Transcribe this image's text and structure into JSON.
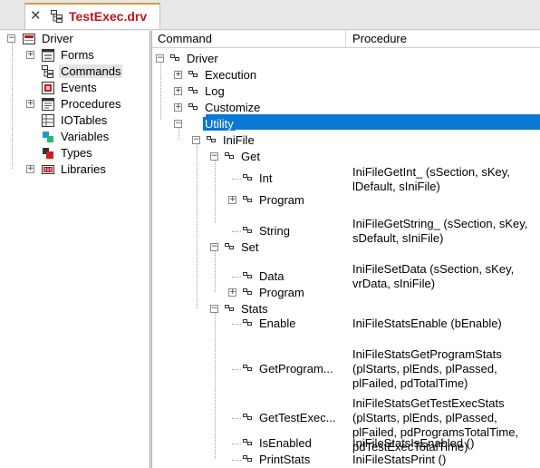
{
  "tab": {
    "close_glyph": "✕",
    "title": "TestExec.drv"
  },
  "left_tree": {
    "root": "Driver",
    "items": [
      {
        "label": "Forms",
        "expandable": true,
        "icon": "forms-icon"
      },
      {
        "label": "Commands",
        "expandable": false,
        "icon": "commands-icon",
        "selected": true
      },
      {
        "label": "Events",
        "expandable": false,
        "icon": "events-icon"
      },
      {
        "label": "Procedures",
        "expandable": true,
        "icon": "procedures-icon"
      },
      {
        "label": "IOTables",
        "expandable": false,
        "icon": "iotables-icon"
      },
      {
        "label": "Variables",
        "expandable": false,
        "icon": "variables-icon"
      },
      {
        "label": "Types",
        "expandable": false,
        "icon": "types-icon"
      },
      {
        "label": "Libraries",
        "expandable": true,
        "icon": "libraries-icon"
      }
    ]
  },
  "columns": {
    "command": "Command",
    "procedure": "Procedure"
  },
  "command_tree": [
    {
      "id": "driver",
      "label": "Driver",
      "procedure": "",
      "expander": "minus",
      "level": 0
    },
    {
      "id": "execution",
      "label": "Execution",
      "procedure": "",
      "expander": "plus",
      "level": 1
    },
    {
      "id": "log",
      "label": "Log",
      "procedure": "",
      "expander": "plus",
      "level": 1
    },
    {
      "id": "customize",
      "label": "Customize",
      "procedure": "",
      "expander": "plus",
      "level": 1
    },
    {
      "id": "utility",
      "label": "Utility",
      "procedure": "",
      "expander": "minus",
      "level": 1,
      "selected": true
    },
    {
      "id": "inifile",
      "label": "IniFile",
      "procedure": "",
      "expander": "minus",
      "level": 2
    },
    {
      "id": "get",
      "label": "Get",
      "procedure": "",
      "expander": "minus",
      "level": 3
    },
    {
      "id": "get-int",
      "label": "Int",
      "procedure": "IniFileGetInt_ (sSection, sKey, lDefault, sIniFile)",
      "expander": "none",
      "level": 4
    },
    {
      "id": "get-program",
      "label": "Program",
      "procedure": "",
      "expander": "plus",
      "level": 4
    },
    {
      "id": "get-string",
      "label": "String",
      "procedure": "IniFileGetString_ (sSection, sKey, sDefault, sIniFile)",
      "expander": "none",
      "level": 4
    },
    {
      "id": "set",
      "label": "Set",
      "procedure": "",
      "expander": "minus",
      "level": 3
    },
    {
      "id": "set-data",
      "label": "Data",
      "procedure": "IniFileSetData (sSection, sKey, vrData, sIniFile)",
      "expander": "none",
      "level": 4
    },
    {
      "id": "set-program",
      "label": "Program",
      "procedure": "",
      "expander": "plus",
      "level": 4
    },
    {
      "id": "stats",
      "label": "Stats",
      "procedure": "",
      "expander": "minus",
      "level": 3
    },
    {
      "id": "stats-enable",
      "label": "Enable",
      "procedure": "IniFileStatsEnable (bEnable)",
      "expander": "none",
      "level": 4
    },
    {
      "id": "stats-getprogram",
      "label": "GetProgram...",
      "procedure": "IniFileStatsGetProgramStats (plStarts, plEnds, plPassed, plFailed, pdTotalTime)",
      "expander": "none",
      "level": 4
    },
    {
      "id": "stats-gettestexec",
      "label": "GetTestExec...",
      "procedure": "IniFileStatsGetTestExecStats (plStarts, plEnds, plPassed, plFailed, pdProgramsTotalTime, pdTestExecTotalTime)",
      "expander": "none",
      "level": 4
    },
    {
      "id": "stats-isenabled",
      "label": "IsEnabled",
      "procedure": "IniFileStatsIsEnabled ()",
      "expander": "none",
      "level": 4
    },
    {
      "id": "stats-printstats",
      "label": "PrintStats",
      "procedure": "IniFileStatsPrint ()",
      "expander": "none",
      "level": 4
    }
  ],
  "colors": {
    "selection": "#0a78d7",
    "tab_title": "#c0141c",
    "tab_accent": "#d89a3a"
  }
}
